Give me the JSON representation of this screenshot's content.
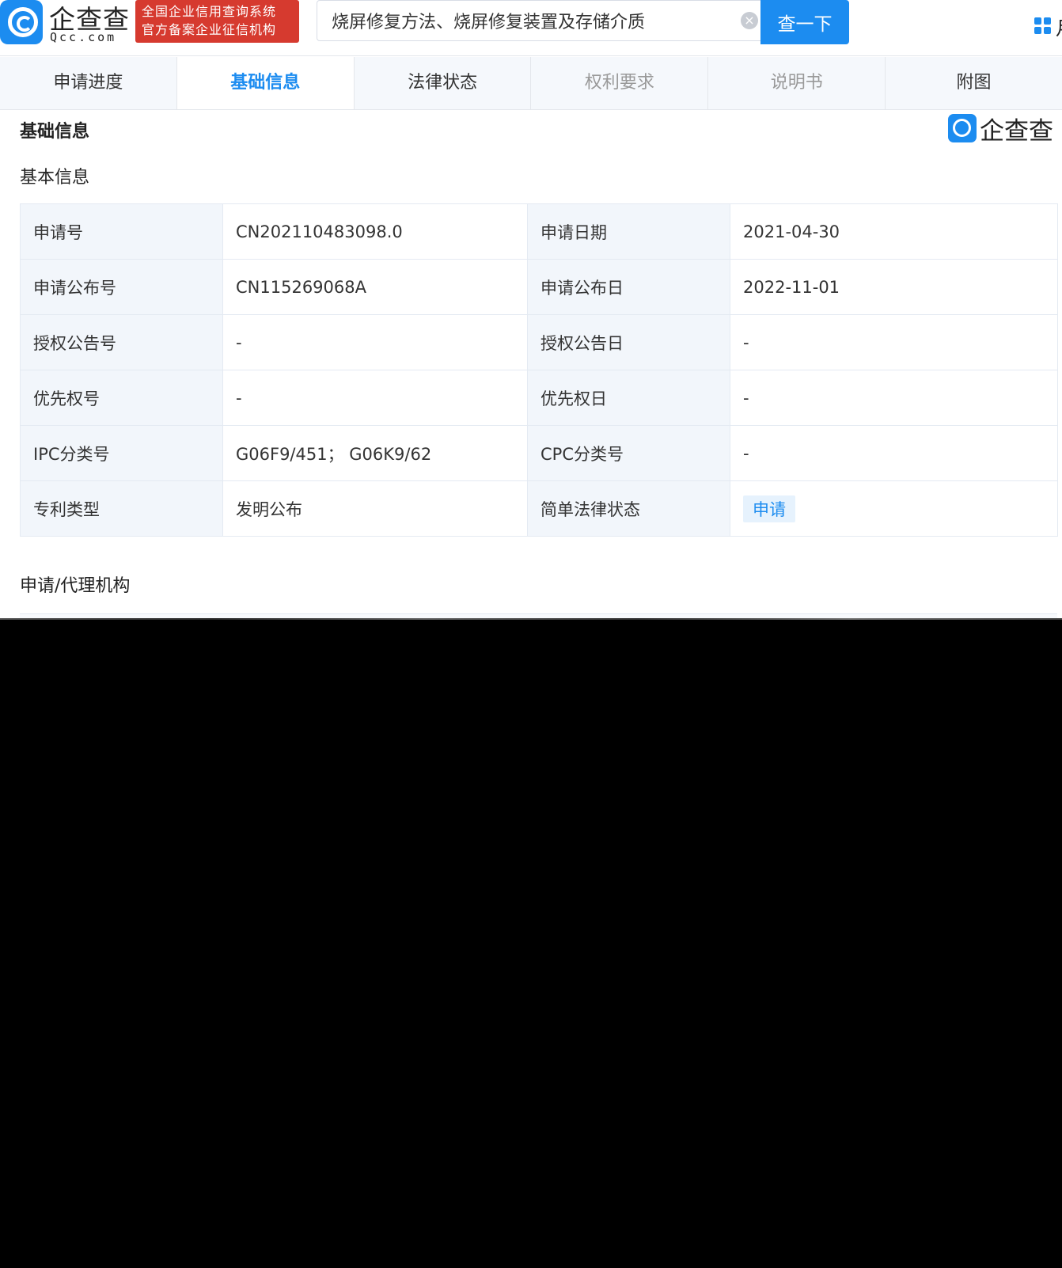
{
  "header": {
    "logo_name": "企查查",
    "logo_domain": "Qcc.com",
    "cert_line1": "全国企业信用查询系统",
    "cert_line2": "官方备案企业征信机构",
    "search_value": "烧屏修复方法、烧屏修复装置及存储介质",
    "clear_icon": "×",
    "search_button": "查一下",
    "cut_char": "月"
  },
  "tabs": [
    {
      "label": "申请进度",
      "state": "normal"
    },
    {
      "label": "基础信息",
      "state": "active"
    },
    {
      "label": "法律状态",
      "state": "normal"
    },
    {
      "label": "权利要求",
      "state": "disabled"
    },
    {
      "label": "说明书",
      "state": "disabled"
    },
    {
      "label": "附图",
      "state": "normal"
    }
  ],
  "section": {
    "title": "基础信息",
    "watermark": "企查查",
    "basic_title": "基本信息",
    "agency_title": "申请/代理机构"
  },
  "basic_info": [
    {
      "l1": "申请号",
      "v1": "CN202110483098.0",
      "l2": "申请日期",
      "v2": "2021-04-30"
    },
    {
      "l1": "申请公布号",
      "v1": "CN115269068A",
      "l2": "申请公布日",
      "v2": "2022-11-01"
    },
    {
      "l1": "授权公告号",
      "v1": "-",
      "l2": "授权公告日",
      "v2": "-"
    },
    {
      "l1": "优先权号",
      "v1": "-",
      "l2": "优先权日",
      "v2": "-"
    },
    {
      "l1": "IPC分类号",
      "v1": "G06F9/451； G06K9/62",
      "l2": "CPC分类号",
      "v2": "-"
    },
    {
      "l1": "专利类型",
      "v1": "发明公布",
      "l2": "简单法律状态",
      "v2": "申请"
    }
  ],
  "colors": {
    "accent": "#1c8cf0",
    "cert_red": "#d63a2f",
    "label_bg": "#f2f6fb"
  }
}
